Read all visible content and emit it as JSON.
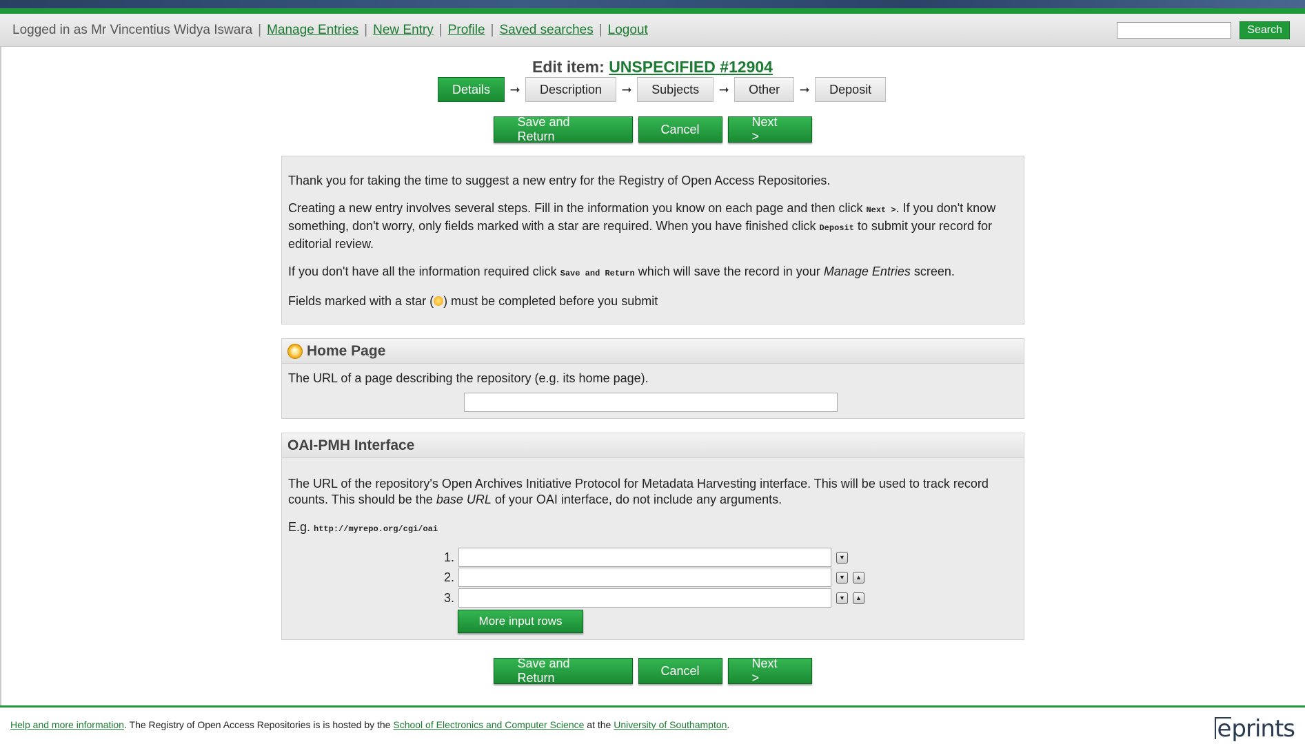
{
  "userbar": {
    "logged_in_text": "Logged in as Mr Vincentius Widya Iswara",
    "links": [
      "Manage Entries",
      "New Entry",
      "Profile",
      "Saved searches",
      "Logout"
    ],
    "search_button": "Search",
    "search_value": ""
  },
  "title": {
    "prefix": "Edit item:",
    "item_link": "UNSPECIFIED #12904"
  },
  "steps": [
    "Details",
    "Description",
    "Subjects",
    "Other",
    "Deposit"
  ],
  "active_step": "Details",
  "buttons": {
    "save": "Save and Return",
    "cancel": "Cancel",
    "next": "Next >"
  },
  "intro": {
    "p1": "Thank you for taking the time to suggest a new entry for the Registry of Open Access Repositories.",
    "p2_a": "Creating a new entry involves several steps. Fill in the information you know on each page and then click ",
    "p2_next": "Next >",
    "p2_b": ". If you don't know something, don't worry, only fields marked with a star are required. When you have finished click ",
    "p2_deposit": "Deposit",
    "p2_c": " to submit your record for editorial review.",
    "p3_a": "If you don't have all the information required click ",
    "p3_save": "Save and Return",
    "p3_b": " which will save the record in your ",
    "p3_manage": "Manage Entries",
    "p3_c": " screen.",
    "p4_a": "Fields marked with a star (",
    "p4_b": ") must be completed before you submit"
  },
  "homepage": {
    "heading": "Home Page",
    "help": "The URL of a page describing the repository (e.g. its home page).",
    "value": ""
  },
  "oai": {
    "heading": "OAI-PMH Interface",
    "help_a": "The URL of the repository's Open Archives Initiative Protocol for Metadata Harvesting interface. This will be used to track record counts. This should be the ",
    "help_em": "base URL",
    "help_b": " of your OAI interface, do not include any arguments.",
    "eg_label": "E.g.",
    "eg_value": "http://myrepo.org/cgi/oai",
    "rows": [
      {
        "num": "1.",
        "value": ""
      },
      {
        "num": "2.",
        "value": ""
      },
      {
        "num": "3.",
        "value": ""
      }
    ],
    "more_rows": "More input rows"
  },
  "footer": {
    "help_link": "Help and more information",
    "text_a": ". The Registry of Open Access Repositories is is hosted by the ",
    "school_link": "School of Electronics and Computer Science",
    "text_b": " at the ",
    "uni_link": "University of Southampton",
    "text_c": ".",
    "logo_e": "e",
    "logo_rest": "prints"
  },
  "colors": {
    "accent_green": "#1e9a39",
    "link_green": "#1b7b31"
  }
}
